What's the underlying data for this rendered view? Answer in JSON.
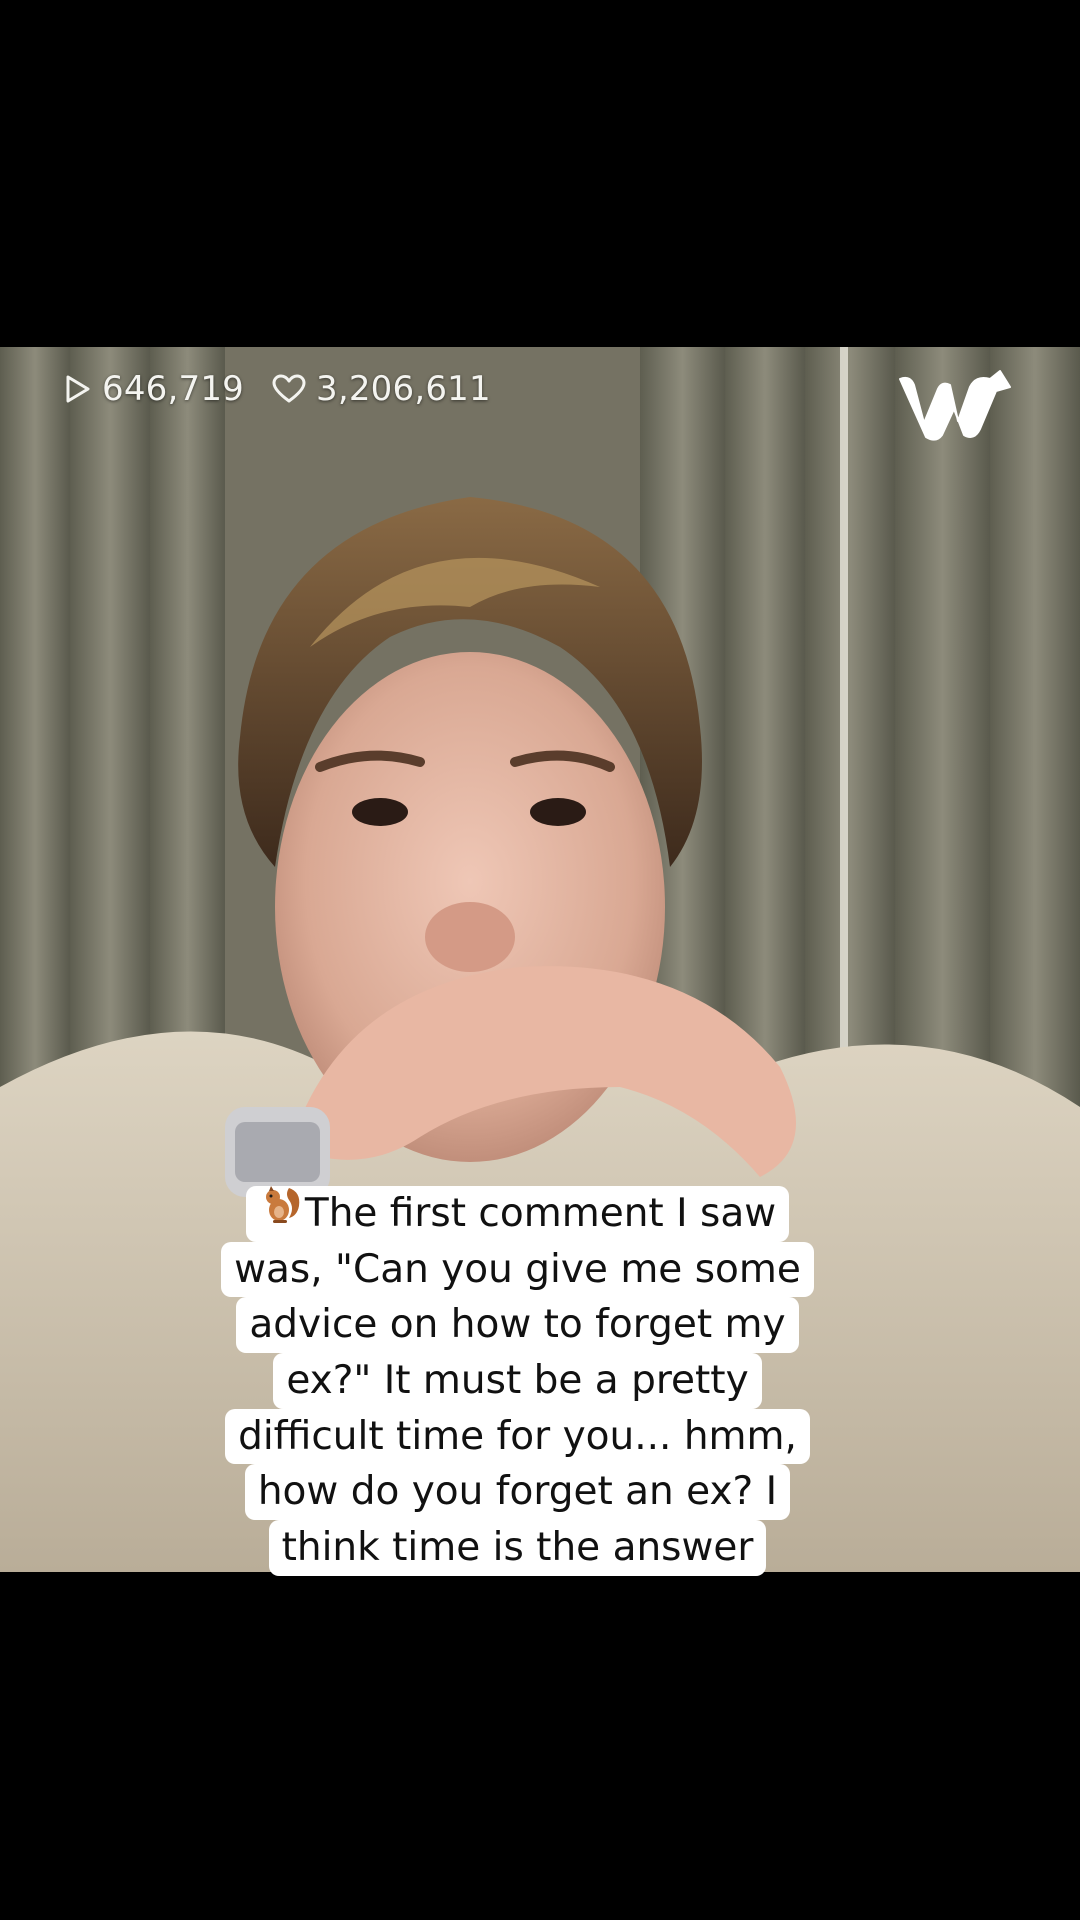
{
  "stats": {
    "views": "646,719",
    "likes": "3,206,611",
    "views_icon": "play-outline-icon",
    "likes_icon": "heart-outline-icon"
  },
  "brand": {
    "logo": "weverse-logo"
  },
  "caption": {
    "emoji": "squirrel-emoji",
    "lines": [
      "The first comment I saw",
      "was, \"Can you give me some",
      "advice on how to forget my",
      "ex?\" It must be a pretty",
      "difficult time for you... hmm,",
      "how do you forget an ex? I",
      "think time is the answer"
    ]
  },
  "colors": {
    "background": "#000000",
    "caption_bg": "#ffffff",
    "caption_text": "#111111",
    "overlay_text": "#f4f4f0"
  }
}
